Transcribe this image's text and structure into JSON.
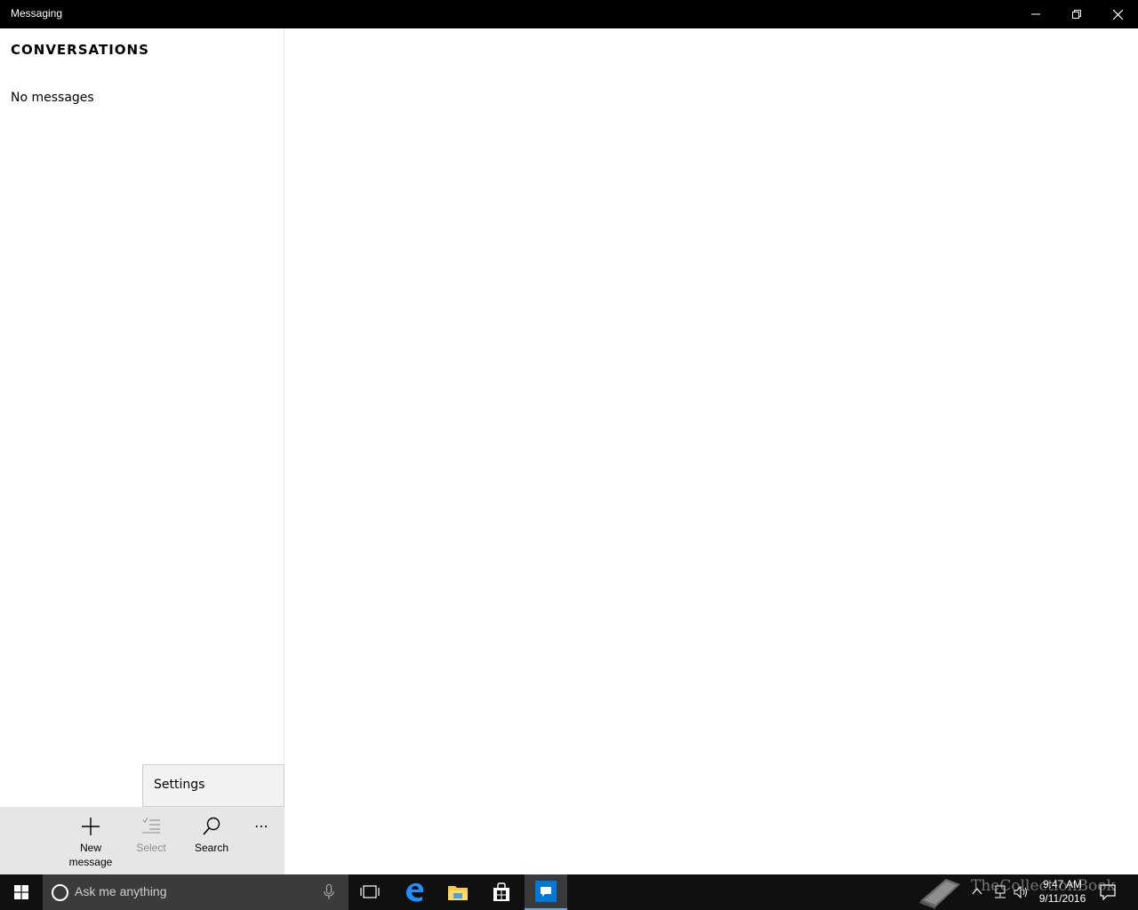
{
  "window": {
    "title": "Messaging",
    "controls": [
      "minimize-icon",
      "restore-icon",
      "close-icon"
    ]
  },
  "sidebar": {
    "heading": "CONVERSATIONS",
    "empty_text": "No messages"
  },
  "more_menu": {
    "items": [
      {
        "label": "Settings"
      }
    ]
  },
  "appbar": {
    "buttons": [
      {
        "label_line1": "New",
        "label_line2": "message",
        "icon": "plus-icon",
        "enabled": true
      },
      {
        "label": "Select",
        "icon": "select-list-icon",
        "enabled": false
      },
      {
        "label": "Search",
        "icon": "search-icon",
        "enabled": true
      },
      {
        "label": "⋯",
        "icon": "more-icon",
        "enabled": true
      }
    ]
  },
  "taskbar": {
    "search_placeholder": "Ask me anything",
    "pinned": [
      "task-view-icon",
      "edge-icon",
      "file-explorer-icon",
      "store-icon",
      "messaging-icon"
    ],
    "clock_time": "9:47 AM",
    "clock_date": "9/11/2016"
  },
  "watermark": {
    "text": "TheCollectionBook"
  },
  "colors": {
    "titlebar": "#000000",
    "appbar": "#e6e6e6",
    "taskbar": "#101010",
    "accent": "#0078d7"
  }
}
